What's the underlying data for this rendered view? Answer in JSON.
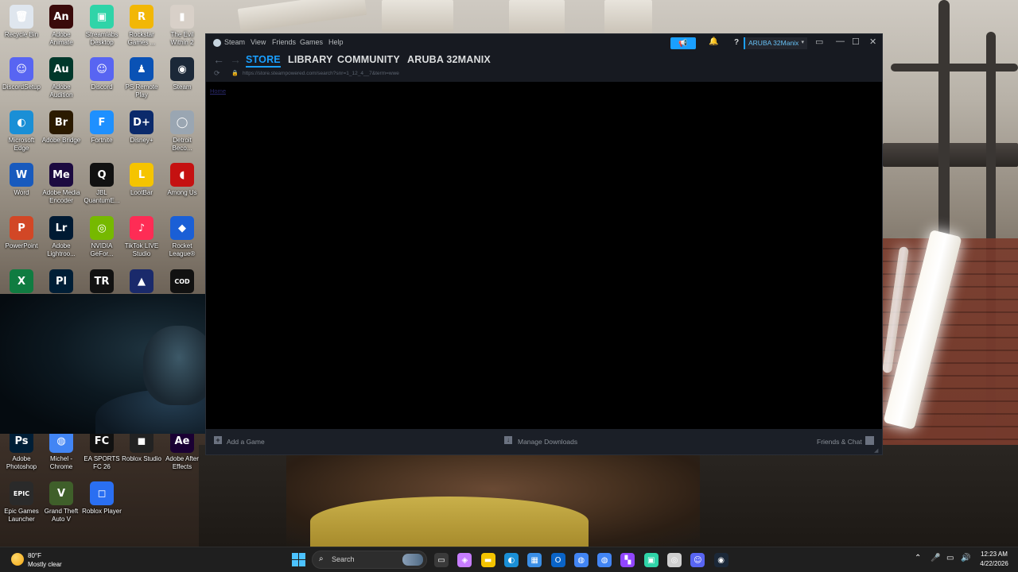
{
  "desktop": {
    "icons": [
      {
        "label": "Recycle Bin",
        "glyph": "🗑",
        "color": "#dfe6ee"
      },
      {
        "label": "Adobe Animate",
        "glyph": "An",
        "color": "#3a0a0a"
      },
      {
        "label": "Streamlabs Desktop",
        "glyph": "▣",
        "color": "#2fd4a8"
      },
      {
        "label": "Rockstar Games ...",
        "glyph": "R",
        "color": "#f2b705"
      },
      {
        "label": "The Evil Within 2",
        "glyph": "▮",
        "color": "#d8d0c8"
      },
      {
        "label": "DiscordSetup",
        "glyph": "☺",
        "color": "#5865f2"
      },
      {
        "label": "Adobe Audition",
        "glyph": "Au",
        "color": "#00382b"
      },
      {
        "label": "Discord",
        "glyph": "☺",
        "color": "#5865f2"
      },
      {
        "label": "PS Remote Play",
        "glyph": "♟",
        "color": "#0a52b5"
      },
      {
        "label": "Steam",
        "glyph": "◉",
        "color": "#1b2838"
      },
      {
        "label": "Microsoft Edge",
        "glyph": "◐",
        "color": "#1a8fd6"
      },
      {
        "label": "Adobe Bridge",
        "glyph": "Br",
        "color": "#2b1a00"
      },
      {
        "label": "Fortnite",
        "glyph": "F",
        "color": "#1e90ff"
      },
      {
        "label": "Disney+",
        "glyph": "D+",
        "color": "#0b2a6b"
      },
      {
        "label": "Detroit Beco...",
        "glyph": "◯",
        "color": "#9aa6b2"
      },
      {
        "label": "Word",
        "glyph": "W",
        "color": "#185abd"
      },
      {
        "label": "Adobe Media Encoder",
        "glyph": "Me",
        "color": "#1c0a40"
      },
      {
        "label": "JBL QuantumE...",
        "glyph": "Q",
        "color": "#111111"
      },
      {
        "label": "LootBar",
        "glyph": "L",
        "color": "#f5c400"
      },
      {
        "label": "Among Us",
        "glyph": "◖",
        "color": "#c51111"
      },
      {
        "label": "PowerPoint",
        "glyph": "P",
        "color": "#d24726"
      },
      {
        "label": "Adobe Lightroo...",
        "glyph": "Lr",
        "color": "#001a33"
      },
      {
        "label": "NVIDIA GeFor...",
        "glyph": "◎",
        "color": "#76b900"
      },
      {
        "label": "TikTok LIVE Studio",
        "glyph": "♪",
        "color": "#fe2c55"
      },
      {
        "label": "Rocket League®",
        "glyph": "◆",
        "color": "#1a5fd6"
      },
      {
        "label": "",
        "glyph": "X",
        "color": "#107c41"
      },
      {
        "label": "",
        "glyph": "Pl",
        "color": "#001e36"
      },
      {
        "label": "",
        "glyph": "TR",
        "color": "#111111"
      },
      {
        "label": "",
        "glyph": "▲",
        "color": "#1a2a6b"
      },
      {
        "label": "",
        "glyph": "COD",
        "color": "#111111"
      },
      {
        "label": "Adobe Photoshop",
        "glyph": "Ps",
        "color": "#001e36"
      },
      {
        "label": "Michel - Chrome",
        "glyph": "◍",
        "color": "#4285f4"
      },
      {
        "label": "EA SPORTS FC 26",
        "glyph": "FC",
        "color": "#111111"
      },
      {
        "label": "Roblox Studio",
        "glyph": "◼",
        "color": "#222222"
      },
      {
        "label": "Adobe After Effects",
        "glyph": "Ae",
        "color": "#1a0033"
      },
      {
        "label": "Epic Games Launcher",
        "glyph": "EPIC",
        "color": "#2a2a2a"
      },
      {
        "label": "Grand Theft Auto V",
        "glyph": "V",
        "color": "#3f5f2a"
      },
      {
        "label": "Roblox Player",
        "glyph": "◻",
        "color": "#2a6ff2"
      }
    ]
  },
  "steam": {
    "title": "Steam",
    "menus": [
      "View",
      "Friends",
      "Games",
      "Help"
    ],
    "account": "ARUBA 32Manix",
    "tabs": [
      "STORE",
      "LIBRARY",
      "COMMUNITY",
      "ARUBA 32MANIX"
    ],
    "url": "https://store.steampowered.com/search?snr=1_12_4__7&term=wwe",
    "content_link": "Home",
    "bottom": {
      "add_game": "Add a Game",
      "manage_downloads": "Manage Downloads",
      "friends_chat": "Friends & Chat"
    },
    "accent": "#1a9fff"
  },
  "taskbar": {
    "weather_temp": "80°F",
    "weather_desc": "Mostly clear",
    "search_placeholder": "Search",
    "time": "12:23 AM",
    "date": "4/22/2026",
    "apps": [
      "task-view",
      "copilot",
      "file-explorer",
      "edge",
      "store",
      "outlook",
      "chrome",
      "chrome",
      "twitch",
      "streamlabs",
      "obs",
      "discord",
      "steam"
    ]
  }
}
